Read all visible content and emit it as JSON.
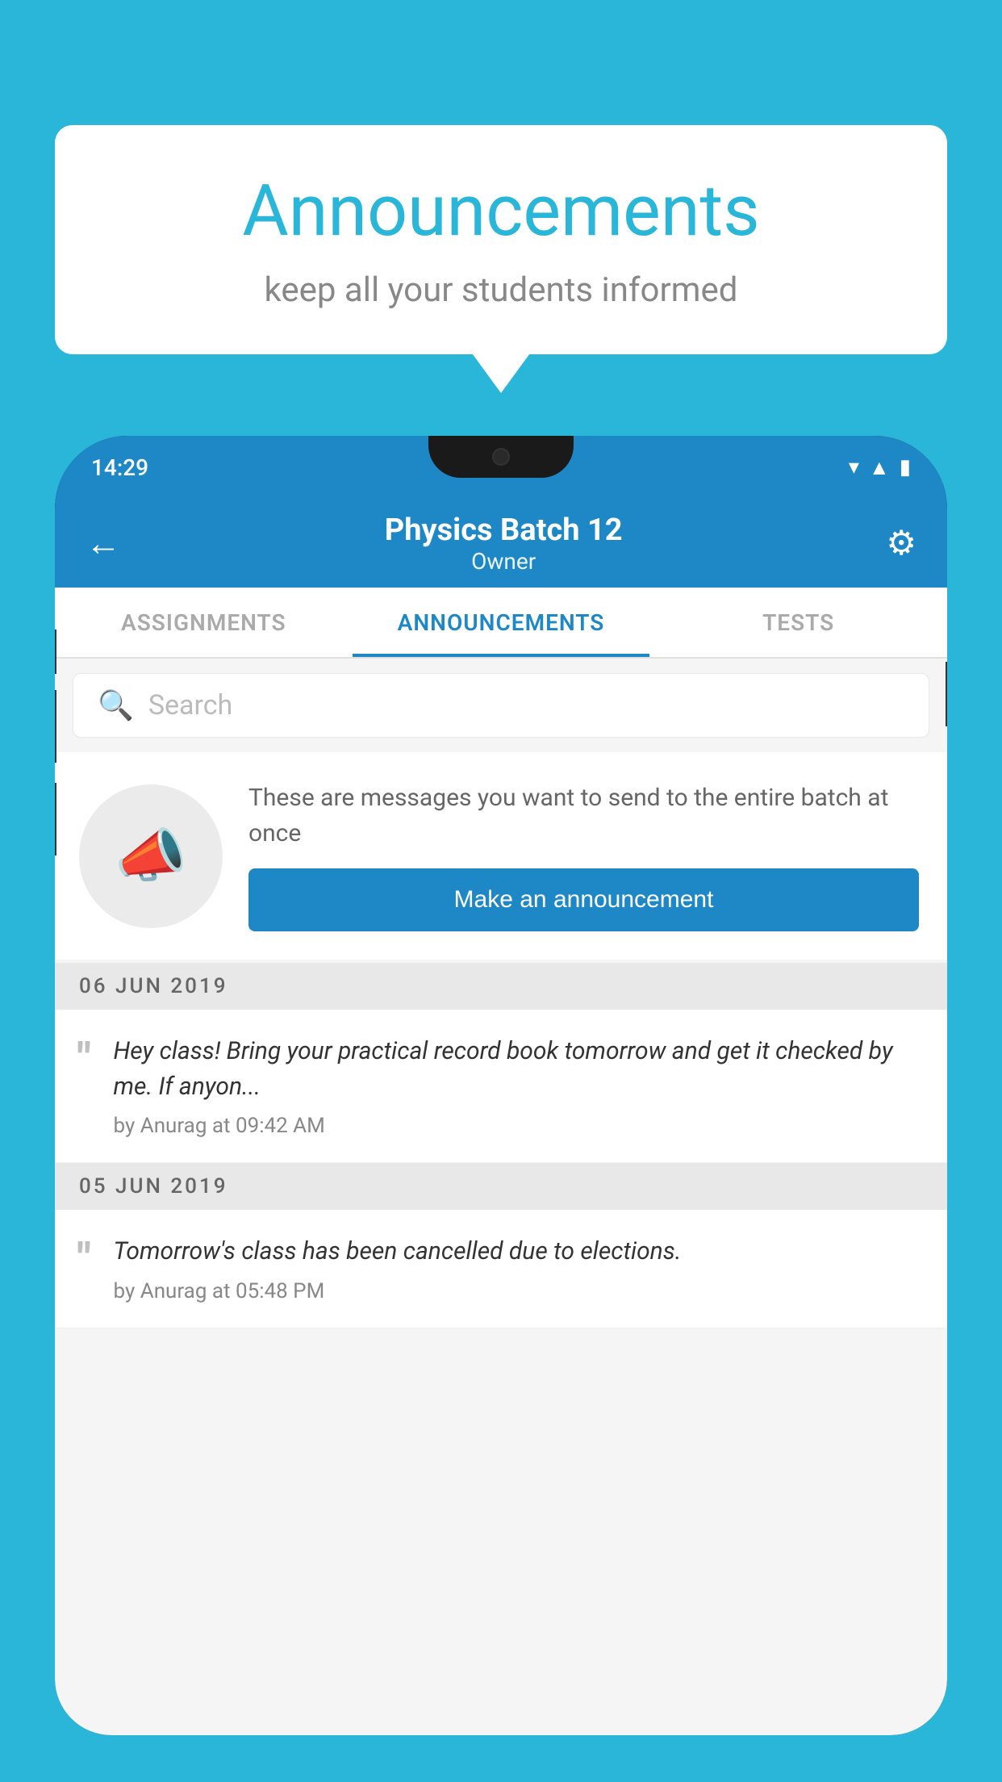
{
  "page": {
    "background_color": "#29b6d8"
  },
  "speech_bubble": {
    "title": "Announcements",
    "subtitle": "keep all your students informed"
  },
  "phone": {
    "status_bar": {
      "time": "14:29"
    },
    "header": {
      "back_label": "←",
      "title": "Physics Batch 12",
      "subtitle": "Owner",
      "settings_label": "⚙"
    },
    "tabs": [
      {
        "label": "ASSIGNMENTS",
        "active": false
      },
      {
        "label": "ANNOUNCEMENTS",
        "active": true
      },
      {
        "label": "TESTS",
        "active": false
      }
    ],
    "search": {
      "placeholder": "Search"
    },
    "promo": {
      "description": "These are messages you want to send to the entire batch at once",
      "button_label": "Make an announcement"
    },
    "announcements": [
      {
        "date": "06  JUN  2019",
        "message": "Hey class! Bring your practical record book tomorrow and get it checked by me. If anyon...",
        "meta": "by Anurag at 09:42 AM"
      },
      {
        "date": "05  JUN  2019",
        "message": "Tomorrow's class has been cancelled due to elections.",
        "meta": "by Anurag at 05:48 PM"
      }
    ]
  }
}
